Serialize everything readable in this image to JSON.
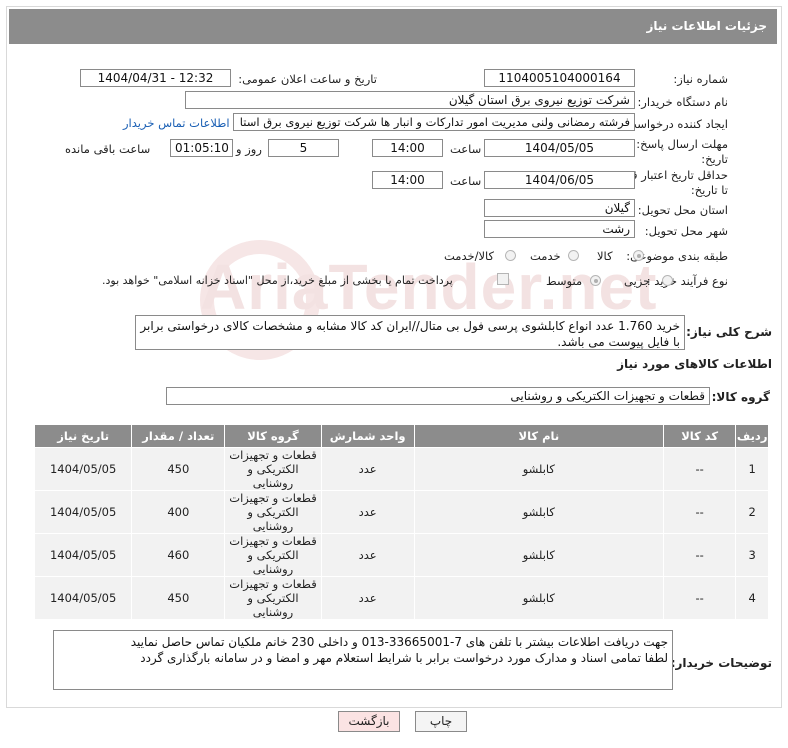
{
  "title": "جزئیات اطلاعات نیاز",
  "watermark": "AriaTender.net",
  "fields": {
    "need_number_label": "شماره نیاز:",
    "need_number": "1104005104000164",
    "announce_label": "تاریخ و ساعت اعلان عمومی:",
    "announce_value": "1404/04/31 - 12:32",
    "buyer_org_label": "نام دستگاه خریدار:",
    "buyer_org": "شرکت توزیع نیروی برق استان گیلان",
    "creator_label": "ایجاد کننده درخواست:",
    "creator": "فرشته رمضانی ولنی مدیریت امور تدارکات و انبار ها شرکت توزیع نیروی برق استا",
    "contact_link": "اطلاعات تماس خریدار",
    "deadline_label_1": "مهلت ارسال پاسخ: تا",
    "deadline_label_2": "تاریخ:",
    "deadline_date": "1404/05/05",
    "time_word": "ساعت",
    "deadline_time": "14:00",
    "days_value": "5",
    "days_word": "روز و",
    "remaining_time": "01:05:10",
    "remaining_word": "ساعت باقی مانده",
    "validity_label_1": "حداقل تاریخ اعتبار قیمت:",
    "validity_label_2": "تا تاریخ:",
    "validity_date": "1404/06/05",
    "validity_time": "14:00",
    "province_label": "استان محل تحویل:",
    "province": "گیلان",
    "city_label": "شهر محل تحویل:",
    "city": "رشت",
    "category_label": "طبقه بندی موضوعی:",
    "category_options": [
      "کالا",
      "خدمت",
      "کالا/خدمت"
    ],
    "process_label": "نوع فرآیند خرید :",
    "process_options": [
      "جزیی",
      "متوسط"
    ],
    "payment_note": "پرداخت تمام یا بخشی از مبلغ خرید،از محل \"اسناد خزانه اسلامی\" خواهد بود.",
    "desc_label": "شرح کلی نیاز:",
    "desc_text": "خرید 1.760 عدد انواع کابلشوی پرسی فول بی متال//ایران کد کالا مشابه و مشخصات کالای درخواستی برابر با فایل پیوست می باشد.",
    "goods_info_label": "اطلاعات کالاهای مورد نیاز",
    "goods_group_label": "گروه کالا:",
    "goods_group": "قطعات و تجهیزات الکتریکی و روشنایی"
  },
  "table": {
    "headers": [
      "ردیف",
      "کد کالا",
      "نام کالا",
      "واحد شمارش",
      "گروه کالا",
      "تعداد / مقدار",
      "تاریخ نیاز"
    ],
    "rows": [
      {
        "row": "1",
        "code": "--",
        "name": "کابلشو",
        "unit": "عدد",
        "group": "قطعات و تجهیزات الکتریکی و روشنایی",
        "qty": "450",
        "date": "1404/05/05"
      },
      {
        "row": "2",
        "code": "--",
        "name": "کابلشو",
        "unit": "عدد",
        "group": "قطعات و تجهیزات الکتریکی و روشنایی",
        "qty": "400",
        "date": "1404/05/05"
      },
      {
        "row": "3",
        "code": "--",
        "name": "کابلشو",
        "unit": "عدد",
        "group": "قطعات و تجهیزات الکتریکی و روشنایی",
        "qty": "460",
        "date": "1404/05/05"
      },
      {
        "row": "4",
        "code": "--",
        "name": "کابلشو",
        "unit": "عدد",
        "group": "قطعات و تجهیزات الکتریکی و روشنایی",
        "qty": "450",
        "date": "1404/05/05"
      }
    ]
  },
  "notes": {
    "label": "توضیحات خریدار:",
    "line1": "جهت دریافت اطلاعات بیشتر با تلفن های 7-33665001-013 و داخلی 230 خانم ملکیان تماس حاصل نمایید",
    "line2": "لطفا تمامی اسناد و مدارک مورد درخواست برابر با شرایط استعلام مهر و امضا و در سامانه بارگذاری گردد"
  },
  "buttons": {
    "print": "چاپ",
    "back": "بازگشت"
  }
}
